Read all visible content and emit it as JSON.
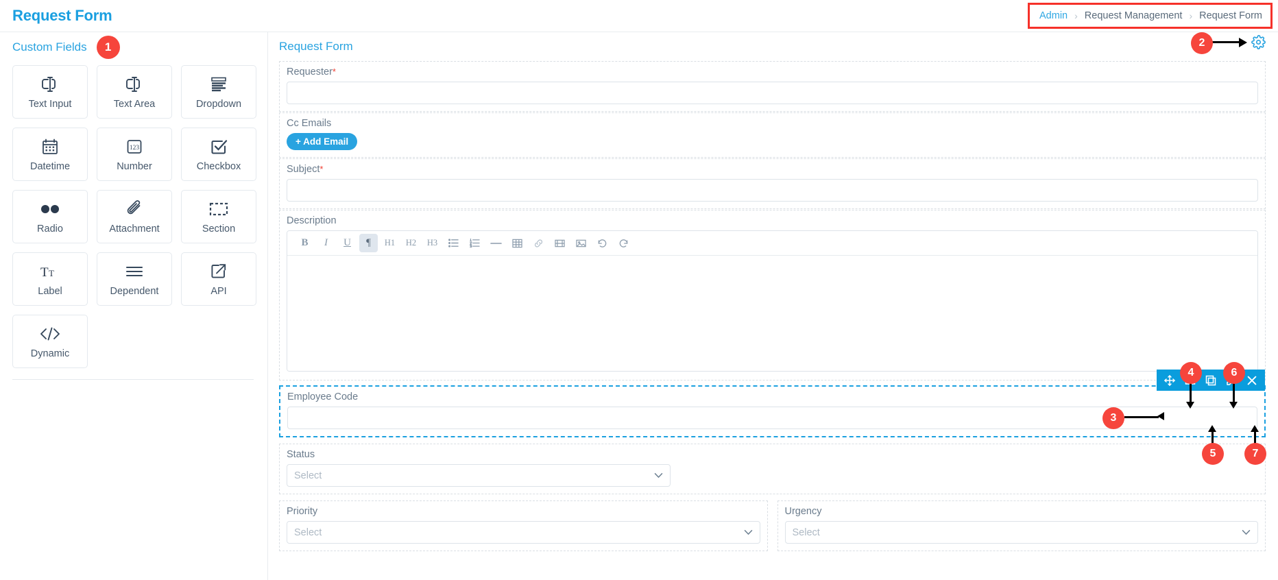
{
  "header": {
    "app_title": "Request Form",
    "breadcrumb": [
      {
        "label": "Admin",
        "type": "link"
      },
      {
        "label": "Request Management",
        "type": "text"
      },
      {
        "label": "Request Form",
        "type": "text"
      }
    ],
    "separator": "›"
  },
  "sidebar": {
    "title": "Custom Fields",
    "badge": "1",
    "items": [
      {
        "label": "Text Input",
        "icon": "text-input-icon"
      },
      {
        "label": "Text Area",
        "icon": "text-area-icon"
      },
      {
        "label": "Dropdown",
        "icon": "dropdown-icon"
      },
      {
        "label": "Datetime",
        "icon": "calendar-icon"
      },
      {
        "label": "Number",
        "icon": "number-123-icon"
      },
      {
        "label": "Checkbox",
        "icon": "checkbox-icon"
      },
      {
        "label": "Radio",
        "icon": "radio-dots-icon"
      },
      {
        "label": "Attachment",
        "icon": "paperclip-icon"
      },
      {
        "label": "Section",
        "icon": "dashed-section-icon"
      },
      {
        "label": "Label",
        "icon": "text-size-icon"
      },
      {
        "label": "Dependent",
        "icon": "lines-icon"
      },
      {
        "label": "API",
        "icon": "external-link-icon"
      },
      {
        "label": "Dynamic",
        "icon": "code-brackets-icon"
      }
    ]
  },
  "form": {
    "title": "Request Form",
    "settings_badge": "2",
    "settings_icon": "gear-icon",
    "fields": {
      "requester": {
        "label": "Requester",
        "required": true,
        "value": "",
        "placeholder": ""
      },
      "cc_emails": {
        "label": "Cc Emails",
        "required": false,
        "button_label": "+ Add Email"
      },
      "subject": {
        "label": "Subject",
        "required": true,
        "value": "",
        "placeholder": ""
      },
      "description": {
        "label": "Description",
        "required": false,
        "value": ""
      },
      "employee_code": {
        "label": "Employee Code",
        "required": false,
        "value": "",
        "selected": true
      },
      "status": {
        "label": "Status",
        "required": false,
        "value": "Select"
      },
      "priority": {
        "label": "Priority",
        "required": false,
        "value": "Select"
      },
      "urgency": {
        "label": "Urgency",
        "required": false,
        "value": "Select"
      }
    },
    "editor_toolbar": [
      {
        "name": "bold-icon",
        "label": "B",
        "active": false
      },
      {
        "name": "italic-icon",
        "label": "I",
        "active": false
      },
      {
        "name": "underline-icon",
        "label": "U",
        "active": false
      },
      {
        "name": "paragraph-icon",
        "label": "¶",
        "active": true
      },
      {
        "name": "heading-1-icon",
        "label": "H1",
        "active": false
      },
      {
        "name": "heading-2-icon",
        "label": "H2",
        "active": false
      },
      {
        "name": "heading-3-icon",
        "label": "H3",
        "active": false
      },
      {
        "name": "bullet-list-icon",
        "label": "",
        "active": false
      },
      {
        "name": "numbered-list-icon",
        "label": "",
        "active": false
      },
      {
        "name": "horizontal-rule-icon",
        "label": "",
        "active": false
      },
      {
        "name": "table-icon",
        "label": "",
        "active": false
      },
      {
        "name": "link-icon",
        "label": "",
        "active": false
      },
      {
        "name": "video-icon",
        "label": "",
        "active": false
      },
      {
        "name": "image-icon",
        "label": "",
        "active": false
      },
      {
        "name": "undo-icon",
        "label": "",
        "active": false
      },
      {
        "name": "redo-icon",
        "label": "",
        "active": false
      }
    ],
    "field_actions": [
      {
        "name": "move-icon",
        "badge": "3"
      },
      {
        "name": "split-columns-icon",
        "badge": "4"
      },
      {
        "name": "duplicate-icon",
        "badge": "5"
      },
      {
        "name": "edit-pencil-icon",
        "badge": "6"
      },
      {
        "name": "close-icon",
        "badge": "7"
      }
    ]
  },
  "colors": {
    "accent": "#29a3e0",
    "badge": "#f6453c",
    "toolbar": "#0a9ddd",
    "required": "#f04134",
    "label": "#6a7b8c"
  }
}
